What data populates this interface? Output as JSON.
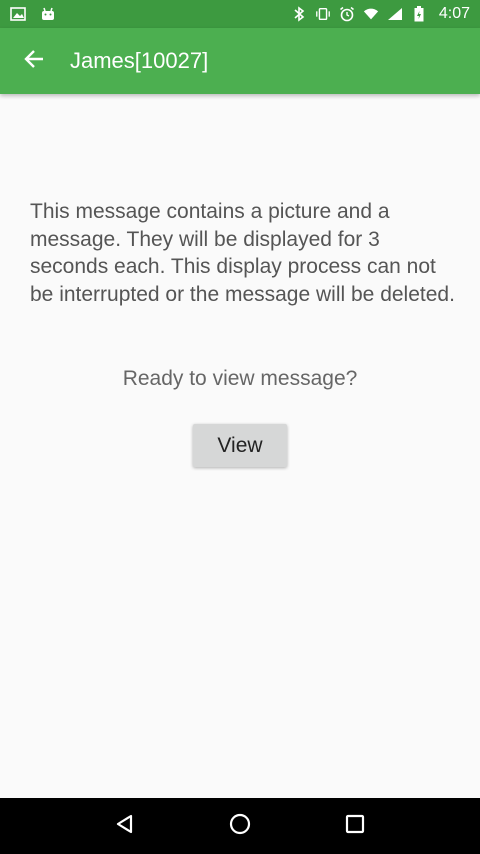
{
  "status_bar": {
    "time": "4:07",
    "icons_left": [
      "image-icon",
      "android-icon"
    ],
    "icons_right": [
      "bluetooth-icon",
      "vibrate-icon",
      "alarm-icon",
      "wifi-icon",
      "signal-icon",
      "battery-icon"
    ]
  },
  "app_bar": {
    "title": "James[10027]",
    "back_icon": "arrow-back-icon"
  },
  "main": {
    "message": "This message contains a picture and a message. They will be displayed for 3 seconds each. This display process can not be interrupted or the message will be deleted.",
    "prompt": "Ready to view message?",
    "view_button_label": "View"
  },
  "nav_bar": {
    "buttons": [
      "back-triangle-icon",
      "home-circle-icon",
      "recents-square-icon"
    ]
  },
  "colors": {
    "status_bar": "#3d9a40",
    "app_bar": "#4caf50",
    "background": "#fafafa",
    "button": "#d6d7d7",
    "nav_bar": "#000000"
  }
}
